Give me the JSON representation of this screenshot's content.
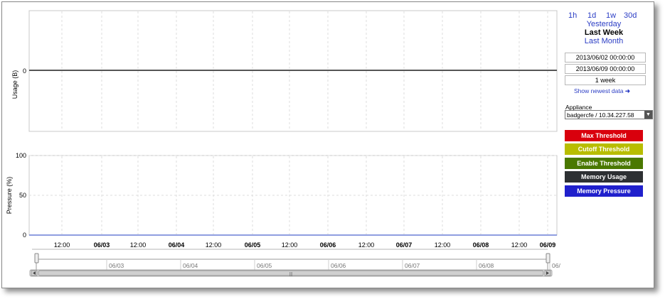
{
  "time_ranges": {
    "short": [
      "1h",
      "1d",
      "1w",
      "30d"
    ],
    "yesterday": "Yesterday",
    "last_week": "Last Week",
    "last_month": "Last Month"
  },
  "start_date": "2013/06/02 00:00:00",
  "end_date": "2013/06/09 00:00:00",
  "duration": "1 week",
  "show_newest": "Show newest data",
  "appliance": {
    "label": "Appliance",
    "value": "badgercfe / 10.34.227.58"
  },
  "legend": [
    {
      "label": "Max Threshold",
      "color": "#d9000d"
    },
    {
      "label": "Cutoff Threshold",
      "color": "#b8bd00"
    },
    {
      "label": "Enable Threshold",
      "color": "#4a7800"
    },
    {
      "label": "Memory Usage",
      "color": "#2d3033"
    },
    {
      "label": "Memory Pressure",
      "color": "#2020cc"
    }
  ],
  "colors": {
    "link": "#2a3cc4",
    "usage_line": "#555555",
    "pressure_line": "#6a7fd6"
  },
  "chart_data": [
    {
      "type": "line",
      "ylabel": "Usage (B)",
      "yticks": [
        0
      ],
      "series": [
        {
          "name": "Memory Usage",
          "values": [
            0,
            0
          ]
        }
      ]
    },
    {
      "type": "line",
      "ylabel": "Pressure (%)",
      "ylim": [
        0,
        100
      ],
      "yticks": [
        0,
        50,
        100
      ],
      "xticks": [
        "12:00",
        "06/03",
        "12:00",
        "06/04",
        "12:00",
        "06/05",
        "12:00",
        "06/06",
        "12:00",
        "06/07",
        "12:00",
        "06/08",
        "12:00",
        "06/09"
      ],
      "series": [
        {
          "name": "Memory Pressure",
          "values": [
            0,
            0
          ]
        }
      ]
    }
  ],
  "navigator": {
    "labels": [
      "06/03",
      "06/04",
      "06/05",
      "06/06",
      "06/07",
      "06/08",
      "06/0"
    ],
    "scroll_grip": "|||"
  }
}
